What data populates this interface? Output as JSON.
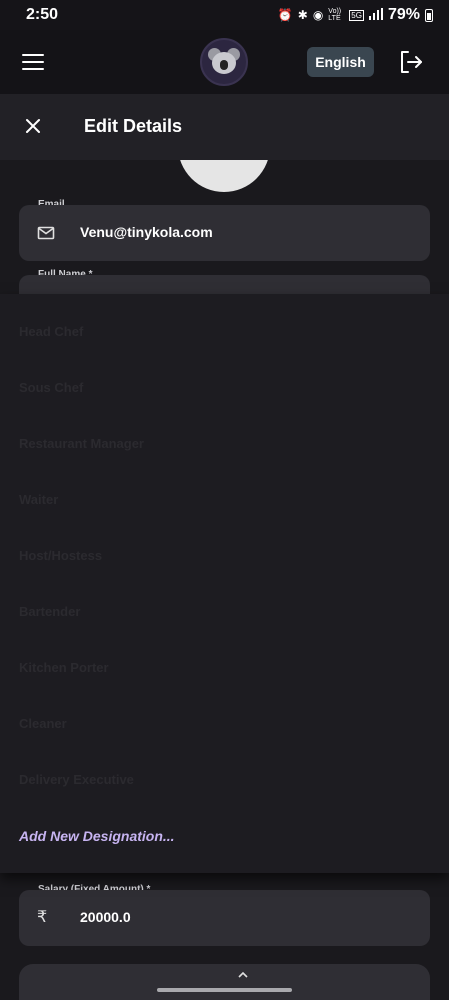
{
  "status_bar": {
    "time": "2:50",
    "battery": "79%",
    "network_labels": [
      "Vo)) LTE",
      "5G"
    ]
  },
  "app_bar": {
    "language_label": "English",
    "icons": [
      "menu-icon",
      "koala-avatar",
      "logout-icon"
    ]
  },
  "sheet": {
    "title": "Edit Details"
  },
  "form": {
    "email_label": "Email",
    "email_value": "Venu@tinykola.com",
    "full_name_label": "Full Name *",
    "salary_label": "Salary (Fixed Amount) *",
    "salary_value": "20000.0",
    "currency_symbol": "₹"
  },
  "designation_menu": {
    "items": [
      "Head Chef",
      "Sous Chef",
      "Restaurant Manager",
      "Waiter",
      "Host/Hostess",
      "Bartender",
      "Kitchen Porter",
      "Cleaner",
      "Delivery Executive"
    ],
    "add_new_label": "Add New Designation..."
  },
  "colors": {
    "background": "#141317",
    "accent": "#c7b4f1",
    "field": "#2f2e34"
  }
}
